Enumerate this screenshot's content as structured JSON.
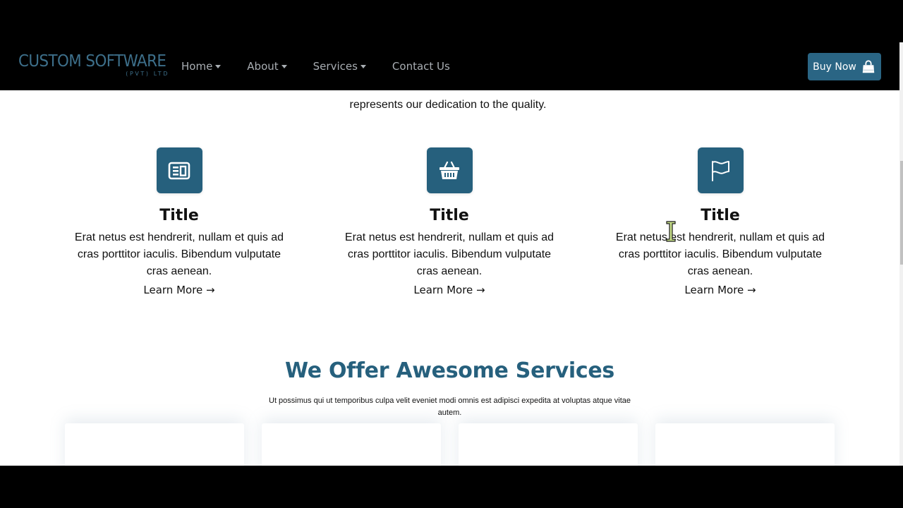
{
  "navbar": {
    "logo_main": "CUSTOM SOFTWARE",
    "logo_sub": "(PVT) LTD",
    "links": [
      {
        "label": "Home",
        "dropdown": true
      },
      {
        "label": "About",
        "dropdown": true
      },
      {
        "label": "Services",
        "dropdown": true
      },
      {
        "label": "Contact Us",
        "dropdown": false
      }
    ],
    "buy_button": {
      "label": "Buy Now",
      "icon": "shopping-bag-icon"
    }
  },
  "intro": {
    "text": "represents our dedication to the quality."
  },
  "features": [
    {
      "icon": "newspaper-icon",
      "title": "Title",
      "text": "Erat netus est hendrerit, nullam et quis ad cras porttitor iaculis. Bibendum vulputate cras aenean.",
      "link": "Learn More →"
    },
    {
      "icon": "basket-icon",
      "title": "Title",
      "text": "Erat netus est hendrerit, nullam et quis ad cras porttitor iaculis. Bibendum vulputate cras aenean.",
      "link": "Learn More →"
    },
    {
      "icon": "flag-icon",
      "title": "Title",
      "text": "Erat netus est hendrerit, nullam et quis ad cras porttitor iaculis. Bibendum vulputate cras aenean.",
      "link": "Learn More →"
    }
  ],
  "services": {
    "heading_light": "We Offer Awesome",
    "heading_bold": "Services",
    "subtitle": "Ut possimus qui ut temporibus culpa velit eveniet modi omnis est adipisci expedita at voluptas atque vitae autem."
  },
  "colors": {
    "brand": "#26607d",
    "button": "#2a6584",
    "nav_text": "#a9aeb3",
    "navbar_bg": "#000000"
  }
}
